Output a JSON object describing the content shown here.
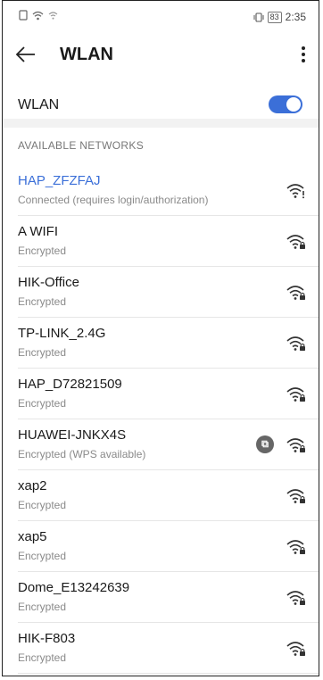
{
  "status_bar": {
    "battery": "83",
    "time": "2:35"
  },
  "header": {
    "title": "WLAN"
  },
  "wlan_toggle": {
    "label": "WLAN",
    "enabled": true
  },
  "section": {
    "title": "AVAILABLE NETWORKS"
  },
  "networks": [
    {
      "name": "HAP_ZFZFAJ",
      "status": "Connected (requires login/authorization)",
      "connected": true,
      "icon": "wifi-alert-icon"
    },
    {
      "name": "A WIFI",
      "status": "Encrypted",
      "icon": "wifi-lock-icon"
    },
    {
      "name": "HIK-Office",
      "status": "Encrypted",
      "icon": "wifi-lock-icon"
    },
    {
      "name": "TP-LINK_2.4G",
      "status": "Encrypted",
      "icon": "wifi-lock-icon"
    },
    {
      "name": "HAP_D72821509",
      "status": "Encrypted",
      "icon": "wifi-lock-icon"
    },
    {
      "name": "HUAWEI-JNKX4S",
      "status": "Encrypted (WPS available)",
      "wps": true,
      "icon": "wifi-lock-icon"
    },
    {
      "name": "xap2",
      "status": "Encrypted",
      "icon": "wifi-lock-icon"
    },
    {
      "name": "xap5",
      "status": "Encrypted",
      "icon": "wifi-lock-icon"
    },
    {
      "name": "Dome_E13242639",
      "status": "Encrypted",
      "icon": "wifi-lock-icon"
    },
    {
      "name": "HIK-F803",
      "status": "Encrypted",
      "icon": "wifi-lock-icon"
    }
  ],
  "colors": {
    "accent": "#3b6fd8",
    "secondary_text": "#8a8a8a"
  }
}
